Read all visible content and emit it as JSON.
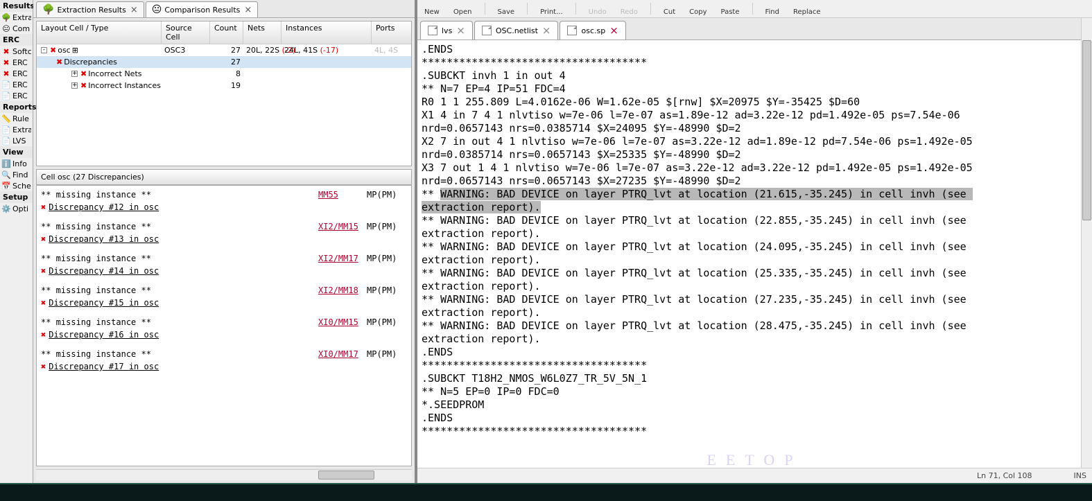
{
  "left_sidebar": {
    "sections": [
      {
        "title": "Results",
        "items": [
          {
            "icon": "tree",
            "label": "Extra"
          },
          {
            "icon": "face",
            "label": "Com"
          }
        ]
      },
      {
        "title": "ERC",
        "items": [
          {
            "icon": "x",
            "label": "Softc"
          },
          {
            "icon": "x",
            "label": "ERC"
          },
          {
            "icon": "x",
            "label": "ERC"
          },
          {
            "icon": "doc",
            "label": "ERC"
          },
          {
            "icon": "doc",
            "label": "ERC"
          }
        ]
      },
      {
        "title": "Reports",
        "items": [
          {
            "icon": "rule",
            "label": "Rule"
          },
          {
            "icon": "doc",
            "label": "Extra"
          },
          {
            "icon": "doc",
            "label": "LVS"
          }
        ]
      },
      {
        "title": "View",
        "items": [
          {
            "icon": "info",
            "label": "Info"
          },
          {
            "icon": "find",
            "label": "Find"
          },
          {
            "icon": "sche",
            "label": "Sche"
          }
        ]
      },
      {
        "title": "Setup",
        "items": [
          {
            "icon": "gear",
            "label": "Opti"
          }
        ]
      }
    ]
  },
  "mid_tabs": [
    {
      "icon": "tree",
      "label": "Extraction Results"
    },
    {
      "icon": "face",
      "label": "Comparison Results",
      "active": true
    }
  ],
  "tree": {
    "headers": [
      "Layout Cell / Type",
      "Source Cell",
      "Count",
      "Nets",
      "Instances",
      "Ports"
    ],
    "rows": [
      {
        "indent": 0,
        "toggle": "-",
        "x": true,
        "name": "osc",
        "badge": true,
        "source": "OSC3",
        "count": "27",
        "nets": "20L, 22S",
        "nets_neg": "(-2)",
        "inst": "24L, 41S",
        "inst_neg": "(-17)",
        "ports": "4L, 4S",
        "ports_gray": true
      },
      {
        "indent": 1,
        "x": true,
        "name": "Discrepancies",
        "count": "27",
        "sel": true
      },
      {
        "indent": 2,
        "toggle": "+",
        "x": true,
        "name": "Incorrect Nets",
        "count": "8"
      },
      {
        "indent": 2,
        "toggle": "+",
        "x": true,
        "name": "Incorrect Instances",
        "count": "19"
      }
    ]
  },
  "disc_header": "Cell osc (27 Discrepancies)",
  "discrepancies": [
    {
      "missing": "** missing instance **",
      "ref": "MM55",
      "type": "MP(PM)",
      "dnum": "Discrepancy #12 in osc"
    },
    {
      "missing": "** missing instance **",
      "ref": "XI2/MM15",
      "type": "MP(PM)",
      "dnum": "Discrepancy #13 in osc"
    },
    {
      "missing": "** missing instance **",
      "ref": "XI2/MM17",
      "type": "MP(PM)",
      "dnum": "Discrepancy #14 in osc"
    },
    {
      "missing": "** missing instance **",
      "ref": "XI2/MM18",
      "type": "MP(PM)",
      "dnum": "Discrepancy #15 in osc"
    },
    {
      "missing": "** missing instance **",
      "ref": "XI0/MM15",
      "type": "MP(PM)",
      "dnum": "Discrepancy #16 in osc"
    },
    {
      "missing": "** missing instance **",
      "ref": "XI0/MM17",
      "type": "MP(PM)",
      "dnum": "Discrepancy #17 in osc"
    }
  ],
  "toolbar": [
    {
      "label": "New"
    },
    {
      "label": "Open"
    },
    {
      "sep": true
    },
    {
      "label": "Save"
    },
    {
      "sep": true
    },
    {
      "label": "Print..."
    },
    {
      "sep": true
    },
    {
      "label": "Undo",
      "dim": true
    },
    {
      "label": "Redo",
      "dim": true
    },
    {
      "sep": true
    },
    {
      "label": "Cut"
    },
    {
      "label": "Copy"
    },
    {
      "label": "Paste"
    },
    {
      "sep": true
    },
    {
      "label": "Find"
    },
    {
      "label": "Replace"
    }
  ],
  "editor_tabs": [
    {
      "label": "lvs",
      "close_gray": true
    },
    {
      "label": "OSC.netlist",
      "close_gray": true
    },
    {
      "label": "osc.sp",
      "active": true
    }
  ],
  "editor_lines": [
    ".ENDS",
    "************************************",
    ".SUBCKT invh 1 in out 4",
    "** N=7 EP=4 IP=51 FDC=4",
    "R0 1 1 255.809 L=4.0162e-06 W=1.62e-05 $[rnw] $X=20975 $Y=-35425 $D=60",
    "X1 4 in 7 4 1 nlvtiso w=7e-06 l=7e-07 as=1.89e-12 ad=3.22e-12 pd=1.492e-05 ps=7.54e-06 nrd=0.0657143 nrs=0.0385714 $X=24095 $Y=-48990 $D=2",
    "X2 7 in out 4 1 nlvtiso w=7e-06 l=7e-07 as=3.22e-12 ad=1.89e-12 pd=7.54e-06 ps=1.492e-05 nrd=0.0385714 nrs=0.0657143 $X=25335 $Y=-48990 $D=2",
    "X3 7 out 1 4 1 nlvtiso w=7e-06 l=7e-07 as=3.22e-12 ad=3.22e-12 pd=1.492e-05 ps=1.492e-05 nrd=0.0657143 nrs=0.0657143 $X=27235 $Y=-48990 $D=2",
    {
      "pre": "** ",
      "hl": "WARNING: BAD DEVICE on layer PTRQ_lvt at location (21.615,-35.245) in cell invh (see",
      "hl2": "extraction report)."
    },
    "** WARNING: BAD DEVICE on layer PTRQ_lvt at location (22.855,-35.245) in cell invh (see extraction report).",
    "** WARNING: BAD DEVICE on layer PTRQ_lvt at location (24.095,-35.245) in cell invh (see extraction report).",
    "** WARNING: BAD DEVICE on layer PTRQ_lvt at location (25.335,-35.245) in cell invh (see extraction report).",
    "** WARNING: BAD DEVICE on layer PTRQ_lvt at location (27.235,-35.245) in cell invh (see extraction report).",
    "** WARNING: BAD DEVICE on layer PTRQ_lvt at location (28.475,-35.245) in cell invh (see extraction report).",
    ".ENDS",
    "************************************",
    ".SUBCKT T18H2_NMOS_W6L0Z7_TR_5V_5N_1",
    "** N=5 EP=0 IP=0 FDC=0",
    "*.SEEDPROM",
    ".ENDS",
    "************************************"
  ],
  "status": {
    "pos": "Ln 71, Col 108",
    "mode": "INS"
  },
  "watermark": "EETOP"
}
